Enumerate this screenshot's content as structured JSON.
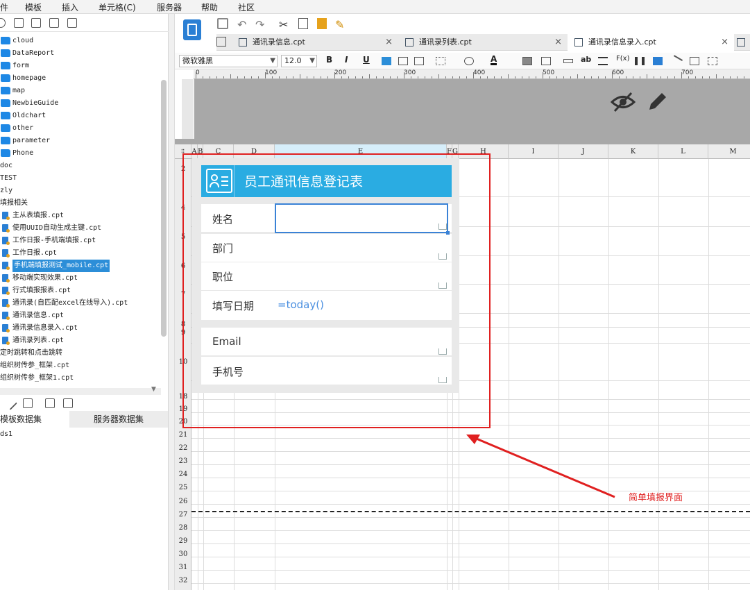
{
  "menu": {
    "items": [
      "件",
      "模板",
      "插入",
      "单元格(C)",
      "服务器",
      "帮助",
      "社区"
    ]
  },
  "tree": {
    "items": [
      {
        "label": "cloud",
        "kind": "folder",
        "indent": 1
      },
      {
        "label": "DataReport",
        "kind": "folder",
        "indent": 1
      },
      {
        "label": "form",
        "kind": "folder",
        "indent": 1
      },
      {
        "label": "homepage",
        "kind": "folder",
        "indent": 1
      },
      {
        "label": "map",
        "kind": "folder",
        "indent": 1
      },
      {
        "label": "NewbieGuide",
        "kind": "folder",
        "indent": 1
      },
      {
        "label": "Oldchart",
        "kind": "folder",
        "indent": 1
      },
      {
        "label": "other",
        "kind": "folder",
        "indent": 1
      },
      {
        "label": "parameter",
        "kind": "folder",
        "indent": 1
      },
      {
        "label": "Phone",
        "kind": "folder",
        "indent": 1
      },
      {
        "label": "doc",
        "kind": "plain",
        "indent": 0
      },
      {
        "label": "TEST",
        "kind": "plain",
        "indent": 0
      },
      {
        "label": "zly",
        "kind": "plain",
        "indent": 0
      },
      {
        "label": "填报相关",
        "kind": "plain",
        "indent": 0
      },
      {
        "label": "主从表填报.cpt",
        "kind": "file",
        "indent": 1
      },
      {
        "label": "使用UUID自动生成主键.cpt",
        "kind": "file",
        "indent": 1
      },
      {
        "label": "工作日报-手机端填报.cpt",
        "kind": "file",
        "indent": 1
      },
      {
        "label": "工作日报.cpt",
        "kind": "file",
        "indent": 1
      },
      {
        "label": "手机端填报测试_mobile.cpt",
        "kind": "file",
        "indent": 1,
        "selected": true
      },
      {
        "label": "移动端实现效果.cpt",
        "kind": "file",
        "indent": 1
      },
      {
        "label": "行式填报报表.cpt",
        "kind": "file",
        "indent": 1
      },
      {
        "label": "通讯录(自匹配excel在线导入).cpt",
        "kind": "file",
        "indent": 1
      },
      {
        "label": "通讯录信息.cpt",
        "kind": "file",
        "indent": 1
      },
      {
        "label": "通讯录信息录入.cpt",
        "kind": "file",
        "indent": 1
      },
      {
        "label": "通讯录列表.cpt",
        "kind": "file",
        "indent": 1
      },
      {
        "label": "定时跳转和点击跳转",
        "kind": "plain",
        "indent": 0
      },
      {
        "label": "组织树传参_框架.cpt",
        "kind": "plain",
        "indent": 0
      },
      {
        "label": "组织树传参_框架1.cpt",
        "kind": "plain",
        "indent": 0
      }
    ]
  },
  "datasets": {
    "tab_template": "模板数据集",
    "tab_server": "服务器数据集",
    "items": [
      "ds1"
    ]
  },
  "tabs": [
    {
      "label": "通讯录信息.cpt",
      "active": false
    },
    {
      "label": "通讯录列表.cpt",
      "active": false
    },
    {
      "label": "通讯录信息录入.cpt",
      "active": true
    }
  ],
  "format": {
    "font": "微软雅黑",
    "size": "12.0",
    "bold": "B",
    "italic": "I",
    "underline": "U",
    "ab": "ab",
    "fx": "F(x)"
  },
  "ruler": [
    "0",
    "100",
    "200",
    "300",
    "400",
    "500",
    "600",
    "700"
  ],
  "columns": [
    "A",
    "B",
    "C",
    "D",
    "E",
    "F",
    "G",
    "H",
    "I",
    "J",
    "K",
    "L",
    "M"
  ],
  "rows": [
    "2",
    "4",
    "5",
    "6",
    "7",
    "8",
    "9",
    "10",
    "18",
    "19",
    "20",
    "21",
    "22",
    "23",
    "24",
    "25",
    "26",
    "27",
    "28",
    "29",
    "30",
    "31",
    "32"
  ],
  "form": {
    "title": "员工通讯信息登记表",
    "fields": [
      {
        "label": "姓名"
      },
      {
        "label": "部门"
      },
      {
        "label": "职位"
      },
      {
        "label": "填写日期",
        "value": "=today()"
      },
      {
        "label": "Email"
      },
      {
        "label": "手机号"
      }
    ]
  },
  "annotation": "简单填报界面",
  "colors": {
    "accent": "#2aace2",
    "annotation": "#e02020",
    "selection": "#2c8ed8"
  }
}
